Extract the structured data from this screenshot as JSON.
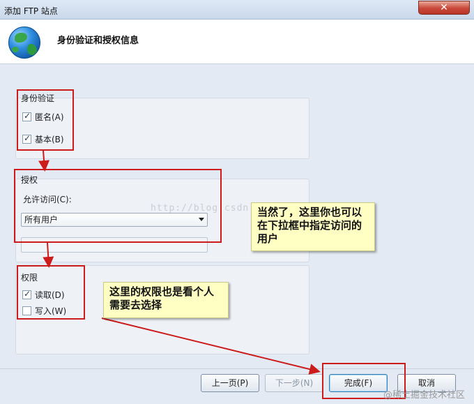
{
  "window": {
    "title": "添加 FTP 站点",
    "close_symbol": "✕"
  },
  "header": {
    "title": "身份验证和授权信息",
    "icon": "globe-icon"
  },
  "authentication": {
    "label": "身份验证",
    "anonymous": {
      "label": "匿名(A)",
      "checked": true
    },
    "basic": {
      "label": "基本(B)",
      "checked": true
    }
  },
  "authorization": {
    "label": "授权",
    "allow_access_label": "允许访问(C):",
    "allow_access_value": "所有用户"
  },
  "permissions": {
    "label": "权限",
    "read": {
      "label": "读取(D)",
      "checked": true
    },
    "write": {
      "label": "写入(W)",
      "checked": false
    }
  },
  "annotations": {
    "note1": "当然了，这里你也可以在下拉框中指定访问的用户",
    "note2": "这里的权限也是看个人需要去选择"
  },
  "buttons": {
    "previous": "上一页(P)",
    "next": "下一步(N)",
    "finish": "完成(F)",
    "cancel": "取消"
  },
  "watermark": "@稀土掘金技术社区",
  "overlay_url": "http://blog.csdn.net/"
}
